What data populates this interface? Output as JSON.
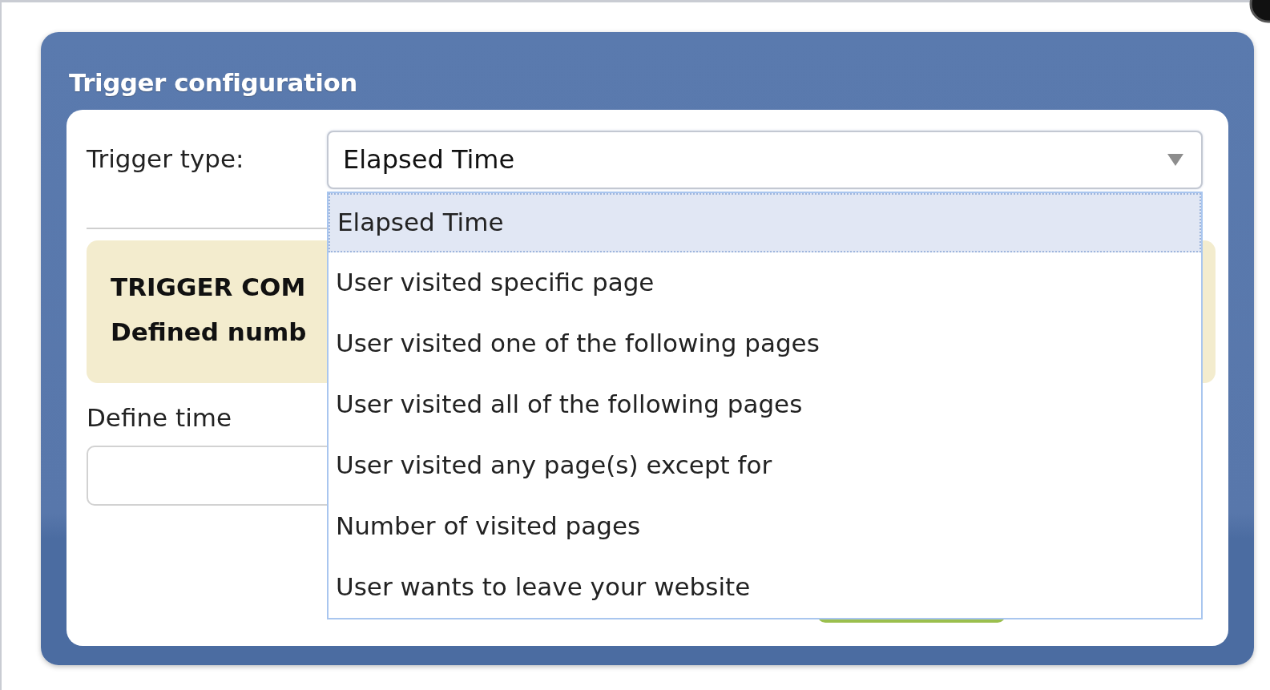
{
  "dialog": {
    "title": "Trigger configuration"
  },
  "trigger_type": {
    "label": "Trigger type:",
    "value": "Elapsed Time",
    "expanded": true,
    "options": [
      {
        "label": "Elapsed Time",
        "selected": true
      },
      {
        "label": "User visited specific page",
        "selected": false
      },
      {
        "label": "User visited one of the following pages",
        "selected": false
      },
      {
        "label": "User visited all of the following pages",
        "selected": false
      },
      {
        "label": "User visited any page(s) except for",
        "selected": false
      },
      {
        "label": "Number of visited pages",
        "selected": false
      },
      {
        "label": "User wants to leave your website",
        "selected": false
      }
    ]
  },
  "alert": {
    "lines": [
      "TRIGGER COM",
      "Defined numb"
    ]
  },
  "define_time": {
    "label": "Define time"
  }
}
